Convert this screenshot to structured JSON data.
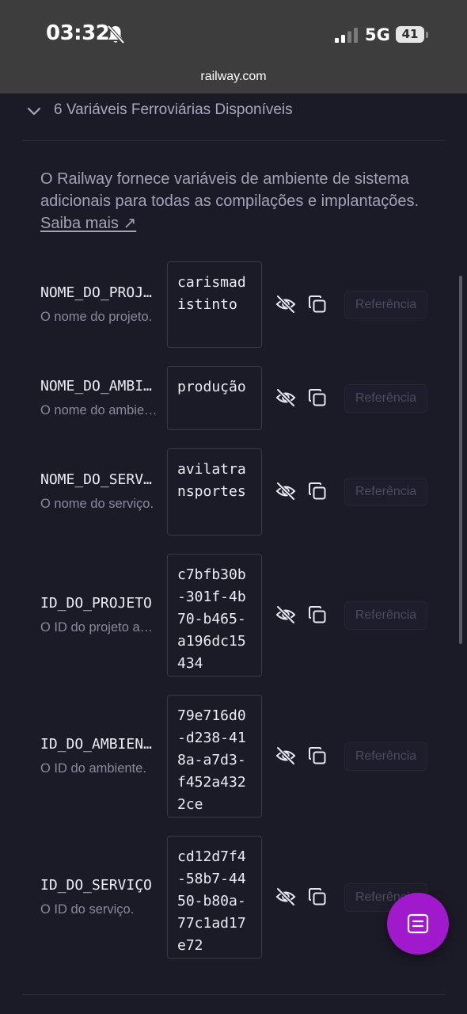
{
  "status_bar": {
    "time": "03:32",
    "network": "5G",
    "battery": "41",
    "url": "railway.com"
  },
  "section": {
    "title": "6 Variáveis Ferroviárias Disponíveis",
    "description": "O Railway fornece variáveis de ambiente de sistema adicionais para todas as compilações e implantações.",
    "learn_more": "Saiba mais ↗"
  },
  "variables": [
    {
      "name": "NOME_DO_PROJETO",
      "description": "O nome do projeto.",
      "value": "carismadistinto",
      "reference_label": "Referência"
    },
    {
      "name": "NOME_DO_AMBIENTE",
      "description": "O nome do ambiente.",
      "value": "produção",
      "reference_label": "Referência"
    },
    {
      "name": "NOME_DO_SERVIÇO",
      "description": "O nome do serviço.",
      "value": "avilatransportes",
      "reference_label": "Referência"
    },
    {
      "name": "ID_DO_PROJETO",
      "description": "O ID do projeto associado.",
      "value": "c7bfb30b-301f-4b70-b465-a196dc15434",
      "reference_label": "Referência"
    },
    {
      "name": "ID_DO_AMBIENTE",
      "description": "O ID do ambiente.",
      "value": "79e716d0-d238-418a-a7d3-f452a4322ce",
      "reference_label": "Referência"
    },
    {
      "name": "ID_DO_SERVIÇO",
      "description": "O ID do serviço.",
      "value": "cd12d7f4-58b7-4450-b80a-77c1ad17e72",
      "reference_label": "Referência"
    }
  ],
  "colors": {
    "background": "#1b1a27",
    "fab": "#a019cc",
    "status_bar": "#3d3d3d"
  }
}
